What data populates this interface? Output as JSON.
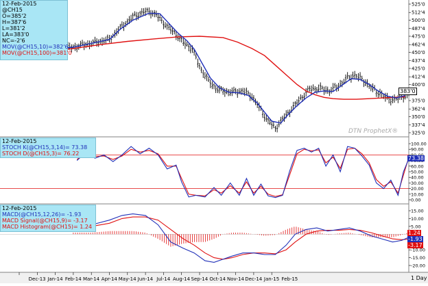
{
  "panels": {
    "price": {
      "date": "12-Feb-2015",
      "symbol": "@CH15",
      "open": "O=385'2",
      "high": "H=387'6",
      "low": "L=381'2",
      "last": "LA=383'0",
      "change": "NC=-2'6",
      "ma_short_label": "MOV(@CH15,10)=382'6",
      "ma_long_label": "MOV(@CH15,100)=381'0",
      "current_tag": "383'0",
      "ticks": [
        {
          "value": 525,
          "label": "525'0"
        },
        {
          "value": 512,
          "label": "512'4"
        },
        {
          "value": 500,
          "label": "500'0"
        },
        {
          "value": 487,
          "label": "487'4"
        },
        {
          "value": 475,
          "label": "475'0"
        },
        {
          "value": 462,
          "label": "462'4"
        },
        {
          "value": 450,
          "label": "450'0"
        },
        {
          "value": 437,
          "label": "437'4"
        },
        {
          "value": 425,
          "label": "425'0"
        },
        {
          "value": 412,
          "label": "412'4"
        },
        {
          "value": 400,
          "label": "400'0"
        },
        {
          "value": 375,
          "label": "375'0"
        },
        {
          "value": 362,
          "label": "362'4"
        },
        {
          "value": 350,
          "label": "350'0"
        },
        {
          "value": 337,
          "label": "337'4"
        },
        {
          "value": 325,
          "label": "325'0"
        }
      ],
      "watermark": "DTN ProphetX®"
    },
    "stoch": {
      "date": "12-Feb-2015",
      "k_label": "STOCH K(@CH15,3,14)= 73.38",
      "d_label": "STOCH D(@CH15,3)= 76.22",
      "k_tag": "73.38",
      "ticks": [
        {
          "value": 100,
          "label": "100.00"
        },
        {
          "value": 90,
          "label": "90.00"
        },
        {
          "value": 80,
          "label": "80.00"
        },
        {
          "value": 70,
          "label": "70.00"
        },
        {
          "value": 60,
          "label": "60.00"
        },
        {
          "value": 50,
          "label": "50.00"
        },
        {
          "value": 40,
          "label": "40.00"
        },
        {
          "value": 30,
          "label": "30.00"
        },
        {
          "value": 20,
          "label": "20.00"
        },
        {
          "value": 10,
          "label": "10.00"
        },
        {
          "value": 0,
          "label": "0.00"
        }
      ]
    },
    "macd": {
      "date": "12-Feb-2015",
      "macd_label": "MACD(@CH15,12,26)= -1.93",
      "signal_label": "MACD Signal(@CH15,9)= -3.17",
      "hist_label": "MACD Histogram(@CH15)= 1.24",
      "tags": [
        "1.24",
        "-1.93",
        "-3.17"
      ],
      "ticks": [
        {
          "value": 15,
          "label": "15.00"
        },
        {
          "value": 10,
          "label": "10.00"
        },
        {
          "value": 5,
          "label": "5.00"
        },
        {
          "value": 0,
          "label": "0.00"
        },
        {
          "value": -5,
          "label": "-5.00"
        },
        {
          "value": -10,
          "label": "-10.00"
        },
        {
          "value": -15,
          "label": "-15.00"
        },
        {
          "value": -20,
          "label": "-20.00"
        }
      ]
    }
  },
  "chart_data": {
    "type": "line",
    "title": "",
    "xlabel": "",
    "ylabel": "",
    "x_ticks": [
      "Dec-13",
      "Jan-14",
      "Feb-14",
      "Mar-14",
      "Apr-14",
      "May-14",
      "Jun-14",
      "Jul-14",
      "Aug-14",
      "Sep-14",
      "Oct-14",
      "Nov-14",
      "Dec-14",
      "Jan-15",
      "Feb-15"
    ],
    "period": "1 Day",
    "price_ylim": [
      325,
      525
    ],
    "stoch_ylim": [
      0,
      100
    ],
    "macd_ylim": [
      -20,
      15
    ],
    "stoch_lines": [
      20,
      80
    ],
    "price_path": [
      [
        0,
        452
      ],
      [
        3,
        458
      ],
      [
        5,
        470
      ],
      [
        5.6,
        488
      ],
      [
        6.3,
        505
      ],
      [
        6.8,
        512
      ],
      [
        7.2,
        514
      ],
      [
        7.6,
        508
      ],
      [
        8.2,
        490
      ],
      [
        8.7,
        478
      ],
      [
        9.1,
        465
      ],
      [
        9.6,
        455
      ],
      [
        10,
        428
      ],
      [
        10.5,
        405
      ],
      [
        11,
        392
      ],
      [
        11.7,
        388
      ],
      [
        12.4,
        390
      ],
      [
        12.9,
        382
      ],
      [
        13.4,
        360
      ],
      [
        13.8,
        343
      ],
      [
        14.2,
        332
      ],
      [
        14.6,
        346
      ],
      [
        15.1,
        362
      ],
      [
        15.6,
        378
      ],
      [
        16.1,
        393
      ],
      [
        16.7,
        394
      ],
      [
        17.2,
        390
      ],
      [
        17.7,
        398
      ],
      [
        18.2,
        410
      ],
      [
        18.6,
        415
      ],
      [
        19.1,
        406
      ],
      [
        19.6,
        393
      ],
      [
        20,
        386
      ],
      [
        20.4,
        378
      ],
      [
        20.8,
        376
      ],
      [
        21.2,
        381
      ],
      [
        21.6,
        384
      ]
    ],
    "series": [
      {
        "name": "MOV(@CH15,10)",
        "color": "#1f2fb8",
        "points": [
          [
            0,
            450
          ],
          [
            3,
            458
          ],
          [
            5,
            470
          ],
          [
            5.6,
            486
          ],
          [
            6.3,
            500
          ],
          [
            6.8,
            506
          ],
          [
            7.2,
            511
          ],
          [
            7.8,
            510
          ],
          [
            8.3,
            495
          ],
          [
            8.8,
            480
          ],
          [
            9.3,
            468
          ],
          [
            9.7,
            455
          ],
          [
            10.1,
            435
          ],
          [
            10.6,
            410
          ],
          [
            11.1,
            395
          ],
          [
            11.6,
            388
          ],
          [
            12.2,
            387
          ],
          [
            12.7,
            383
          ],
          [
            13.2,
            371
          ],
          [
            13.6,
            357
          ],
          [
            14,
            343
          ],
          [
            14.5,
            340
          ],
          [
            14.9,
            353
          ],
          [
            15.4,
            367
          ],
          [
            15.9,
            379
          ],
          [
            16.4,
            388
          ],
          [
            16.9,
            390
          ],
          [
            17.4,
            389
          ],
          [
            17.9,
            399
          ],
          [
            18.4,
            409
          ],
          [
            18.9,
            408
          ],
          [
            19.4,
            400
          ],
          [
            19.9,
            390
          ],
          [
            20.4,
            382
          ],
          [
            20.9,
            379
          ],
          [
            21.4,
            382.75
          ]
        ]
      },
      {
        "name": "MOV(@CH15,100)",
        "color": "#e01010",
        "points": [
          [
            0,
            447
          ],
          [
            1.5,
            451
          ],
          [
            3,
            456
          ],
          [
            4.5,
            462
          ],
          [
            6,
            467
          ],
          [
            7.5,
            471
          ],
          [
            8.8,
            474
          ],
          [
            10,
            475
          ],
          [
            11.3,
            473
          ],
          [
            12.1,
            466
          ],
          [
            12.9,
            456
          ],
          [
            13.6,
            445
          ],
          [
            14.2,
            430
          ],
          [
            14.8,
            415
          ],
          [
            15.4,
            400
          ],
          [
            15.9,
            390
          ],
          [
            16.4,
            384
          ],
          [
            16.9,
            380
          ],
          [
            17.4,
            378
          ],
          [
            18,
            377
          ],
          [
            18.7,
            377
          ],
          [
            19.4,
            378
          ],
          [
            20.1,
            379
          ],
          [
            20.8,
            380
          ],
          [
            21.4,
            381
          ]
        ]
      },
      {
        "name": "STOCH K(@CH15,3,14)",
        "color": "#1f2fb8",
        "points": [
          [
            3.2,
            70
          ],
          [
            3.7,
            85
          ],
          [
            4.2,
            74
          ],
          [
            4.7,
            80
          ],
          [
            5.2,
            68
          ],
          [
            5.7,
            80
          ],
          [
            6.2,
            95
          ],
          [
            6.7,
            82
          ],
          [
            7.2,
            92
          ],
          [
            7.7,
            80
          ],
          [
            8.2,
            55
          ],
          [
            8.7,
            62
          ],
          [
            9,
            32
          ],
          [
            9.4,
            5
          ],
          [
            9.8,
            8
          ],
          [
            10.3,
            5
          ],
          [
            10.8,
            22
          ],
          [
            11.2,
            8
          ],
          [
            11.7,
            30
          ],
          [
            12.2,
            8
          ],
          [
            12.6,
            38
          ],
          [
            13,
            8
          ],
          [
            13.4,
            28
          ],
          [
            13.8,
            7
          ],
          [
            14.2,
            4
          ],
          [
            14.6,
            8
          ],
          [
            15,
            52
          ],
          [
            15.4,
            88
          ],
          [
            15.8,
            92
          ],
          [
            16.2,
            85
          ],
          [
            16.6,
            92
          ],
          [
            17,
            60
          ],
          [
            17.4,
            80
          ],
          [
            17.8,
            50
          ],
          [
            18.2,
            95
          ],
          [
            18.6,
            92
          ],
          [
            19.0,
            78
          ],
          [
            19.4,
            62
          ],
          [
            19.8,
            30
          ],
          [
            20.2,
            20
          ],
          [
            20.6,
            35
          ],
          [
            21.0,
            8
          ],
          [
            21.3,
            50
          ],
          [
            21.6,
            73.38
          ]
        ]
      },
      {
        "name": "STOCH D(@CH15,3)",
        "color": "#e01010",
        "points": [
          [
            3.2,
            72
          ],
          [
            3.7,
            82
          ],
          [
            4.2,
            77
          ],
          [
            4.7,
            78
          ],
          [
            5.2,
            72
          ],
          [
            5.7,
            78
          ],
          [
            6.2,
            90
          ],
          [
            6.7,
            85
          ],
          [
            7.2,
            88
          ],
          [
            7.7,
            82
          ],
          [
            8.2,
            60
          ],
          [
            8.7,
            60
          ],
          [
            9,
            38
          ],
          [
            9.4,
            10
          ],
          [
            9.8,
            8
          ],
          [
            10.3,
            7
          ],
          [
            10.8,
            18
          ],
          [
            11.2,
            12
          ],
          [
            11.7,
            25
          ],
          [
            12.2,
            12
          ],
          [
            12.6,
            32
          ],
          [
            13,
            12
          ],
          [
            13.4,
            24
          ],
          [
            13.8,
            10
          ],
          [
            14.2,
            6
          ],
          [
            14.6,
            9
          ],
          [
            15,
            45
          ],
          [
            15.4,
            82
          ],
          [
            15.8,
            90
          ],
          [
            16.2,
            87
          ],
          [
            16.6,
            89
          ],
          [
            17,
            66
          ],
          [
            17.4,
            76
          ],
          [
            17.8,
            56
          ],
          [
            18.2,
            90
          ],
          [
            18.6,
            92
          ],
          [
            19.0,
            82
          ],
          [
            19.4,
            66
          ],
          [
            19.8,
            36
          ],
          [
            20.2,
            24
          ],
          [
            20.6,
            32
          ],
          [
            21.0,
            12
          ],
          [
            21.3,
            44
          ],
          [
            21.6,
            76.22
          ]
        ]
      },
      {
        "name": "MACD(@CH15,12,26)",
        "color": "#1f2fb8",
        "points": [
          [
            3,
            5
          ],
          [
            4,
            6
          ],
          [
            5,
            9
          ],
          [
            5.7,
            12
          ],
          [
            6.3,
            13
          ],
          [
            7,
            12
          ],
          [
            7.7,
            6
          ],
          [
            8.4,
            -5
          ],
          [
            9.1,
            -9
          ],
          [
            9.7,
            -12
          ],
          [
            10.3,
            -17
          ],
          [
            10.8,
            -18
          ],
          [
            11.3,
            -16
          ],
          [
            11.8,
            -14
          ],
          [
            12.4,
            -12
          ],
          [
            13,
            -12
          ],
          [
            13.6,
            -13
          ],
          [
            14.2,
            -13
          ],
          [
            14.8,
            -7
          ],
          [
            15.3,
            0
          ],
          [
            15.9,
            3
          ],
          [
            16.5,
            4
          ],
          [
            17.1,
            2
          ],
          [
            17.7,
            3
          ],
          [
            18.3,
            4
          ],
          [
            18.9,
            2
          ],
          [
            19.5,
            -1
          ],
          [
            20.1,
            -3
          ],
          [
            20.7,
            -5
          ],
          [
            21.2,
            -4
          ],
          [
            21.6,
            -1.93
          ]
        ]
      },
      {
        "name": "MACD Signal(@CH15,9)",
        "color": "#e01010",
        "points": [
          [
            3,
            4
          ],
          [
            4,
            5
          ],
          [
            5,
            7
          ],
          [
            5.7,
            10
          ],
          [
            6.3,
            11
          ],
          [
            7,
            11
          ],
          [
            7.7,
            9
          ],
          [
            8.4,
            3
          ],
          [
            9.1,
            -3
          ],
          [
            9.7,
            -7
          ],
          [
            10.3,
            -12
          ],
          [
            10.8,
            -15
          ],
          [
            11.3,
            -16
          ],
          [
            11.8,
            -15
          ],
          [
            12.4,
            -13
          ],
          [
            13,
            -12
          ],
          [
            13.6,
            -12
          ],
          [
            14.2,
            -12.5
          ],
          [
            14.8,
            -10
          ],
          [
            15.3,
            -5
          ],
          [
            15.9,
            0
          ],
          [
            16.5,
            2
          ],
          [
            17.1,
            2.5
          ],
          [
            17.7,
            2.5
          ],
          [
            18.3,
            3
          ],
          [
            18.9,
            2.5
          ],
          [
            19.5,
            1
          ],
          [
            20.1,
            -1
          ],
          [
            20.7,
            -3
          ],
          [
            21.2,
            -3.5
          ],
          [
            21.6,
            -3.17
          ]
        ]
      }
    ]
  }
}
